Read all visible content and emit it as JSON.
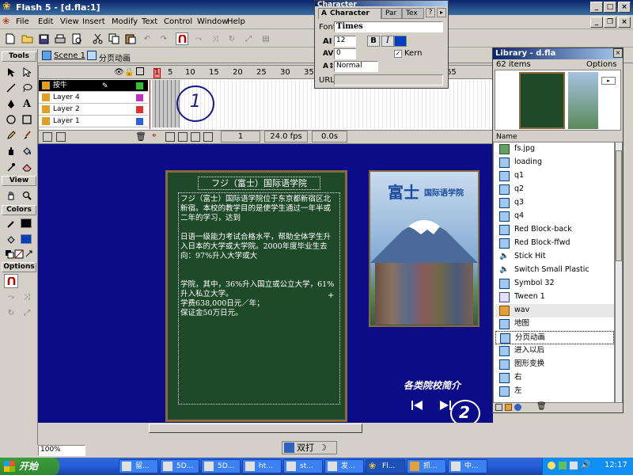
{
  "window": {
    "title": "Flash 5 - [d.fla:1]"
  },
  "menu": [
    "File",
    "Edit",
    "View",
    "Insert",
    "Modify",
    "Text",
    "Control",
    "Window",
    "Help"
  ],
  "tools": {
    "sections": [
      "Tools",
      "View",
      "Colors",
      "Options"
    ]
  },
  "scene": {
    "scene_label": "Scene 1",
    "symbol_label": "分页动画"
  },
  "timeline": {
    "frame_numbers": [
      "1",
      "5",
      "10",
      "15",
      "20",
      "25",
      "30",
      "35",
      "40",
      "45",
      "50",
      "55",
      "60",
      "65"
    ],
    "layers": [
      "按牛",
      "Layer 4",
      "Layer 2",
      "Layer 1"
    ],
    "current_frame": "1",
    "fps": "24.0 fps",
    "time": "0.0s",
    "annotation": "1"
  },
  "board": {
    "title": "フジ（富士）国际语学院",
    "text": "フジ（富士）国际语学院位于东京都新宿区北新宿。本校的教学目的是使学生通过一年半或二年的学习，达到\n\n日语一级能力考试合格水平，帮助全体学生升入日本的大学或大学院。2000年度毕业生去向：97%升入大学或大\n\n\n学院，其中，36%升入国立或公立大学，61%升入私立大学。\n学费638,000日元／年；\n保证金50万日元。"
  },
  "photo": {
    "title": "富士",
    "subtitle": "国际语学院"
  },
  "stage": {
    "caption": "各类院校简介",
    "annotation": "2"
  },
  "status": {
    "zoom": "100%",
    "ime_label": "双打"
  },
  "character_panel": {
    "title": "Character",
    "tabs": [
      "Character",
      "Par",
      "Tex"
    ],
    "font_label": "Font:",
    "font": "Times",
    "size": "12",
    "tracking": "0",
    "baseline": "Normal",
    "kern_label": "Kern",
    "url_label": "URL:"
  },
  "library": {
    "title": "Library - d.fla",
    "count": "62 items",
    "options": "Options",
    "column": "Name",
    "items": [
      {
        "name": "fs.jpg",
        "type": "bitmap"
      },
      {
        "name": "loading",
        "type": "movie"
      },
      {
        "name": "q1",
        "type": "movie"
      },
      {
        "name": "q2",
        "type": "movie"
      },
      {
        "name": "q3",
        "type": "movie"
      },
      {
        "name": "q4",
        "type": "movie"
      },
      {
        "name": "Red Block-back",
        "type": "movie"
      },
      {
        "name": "Red Block-ffwd",
        "type": "movie"
      },
      {
        "name": "Stick Hit",
        "type": "sound"
      },
      {
        "name": "Switch Small Plastic",
        "type": "sound"
      },
      {
        "name": "Symbol 32",
        "type": "movie"
      },
      {
        "name": "Tween 1",
        "type": "graphic"
      },
      {
        "name": "wav",
        "type": "folder"
      },
      {
        "name": "地图",
        "type": "movie"
      },
      {
        "name": "分页动画",
        "type": "movie"
      },
      {
        "name": "进入以后",
        "type": "movie"
      },
      {
        "name": "图形变换",
        "type": "movie"
      },
      {
        "name": "右",
        "type": "movie"
      },
      {
        "name": "左",
        "type": "movie"
      }
    ]
  },
  "taskbar": {
    "start": "开始",
    "tasks": [
      "留...",
      "5D...",
      "5D...",
      "ht...",
      "st...",
      "发...",
      "Fl...",
      "抓...",
      "中..."
    ],
    "clock": "12:17"
  }
}
